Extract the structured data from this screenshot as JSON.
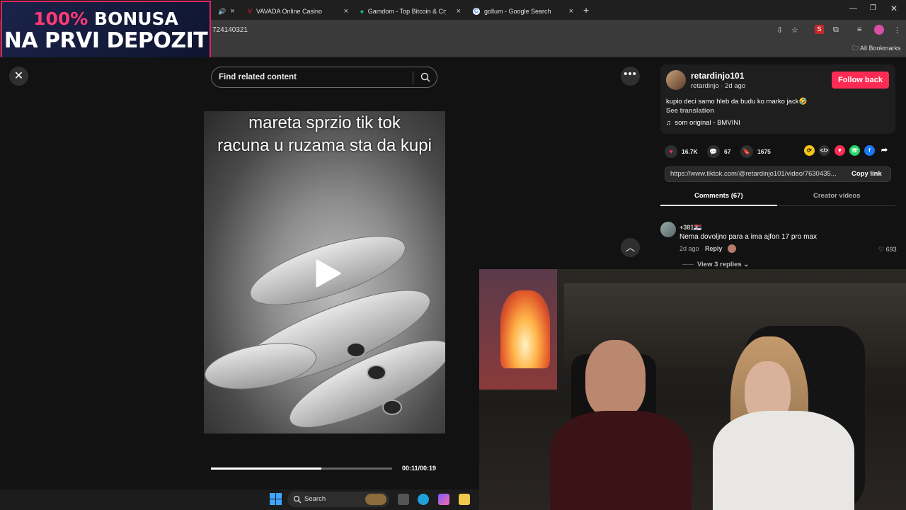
{
  "promo": {
    "percent": "100%",
    "line1_rest": " BONUSA",
    "line2": "NA PRVI DEPOZIT"
  },
  "browser": {
    "tabs": [
      {
        "label": "VAVADA Online Casino",
        "favicon_color": "#c8102e"
      },
      {
        "label": "Gamdom - Top Bitcoin & Crypto",
        "favicon_color": "#20c997"
      },
      {
        "label": "gollum - Google Search",
        "favicon_color": "#4285f4"
      }
    ],
    "url_fragment": "724140321",
    "bookmarks_label": "All Bookmarks"
  },
  "viewer": {
    "search_placeholder": "Find related content",
    "caption_line1": "mareta sprzio tik tok",
    "caption_line2": "racuna u ruzama sta da kupi",
    "time": "00:11/00:19",
    "progress": 0.61
  },
  "post": {
    "username": "retardinjo101",
    "subline": "retardinjo · 2d ago",
    "follow_label": "Follow back",
    "description": "kupio deci samo hleb da budu ko marko jack🤣",
    "see_translation": "See translation",
    "music": "som original - BMVINI",
    "likes": "16.7K",
    "comments": "67",
    "saves": "1675",
    "link": "https://www.tiktok.com/@retardinjo101/video/7630435...",
    "copy_label": "Copy link",
    "tab_comments": "Comments (67)",
    "tab_creator": "Creator videos"
  },
  "comment": {
    "user": "+381🇷🇸",
    "text": "Nema dovoljno para a ima ajfon 17 pro max",
    "date": "2d ago",
    "reply": "Reply",
    "likes": "693",
    "view_replies": "View 3 replies"
  },
  "taskbar": {
    "search_label": "Search"
  }
}
